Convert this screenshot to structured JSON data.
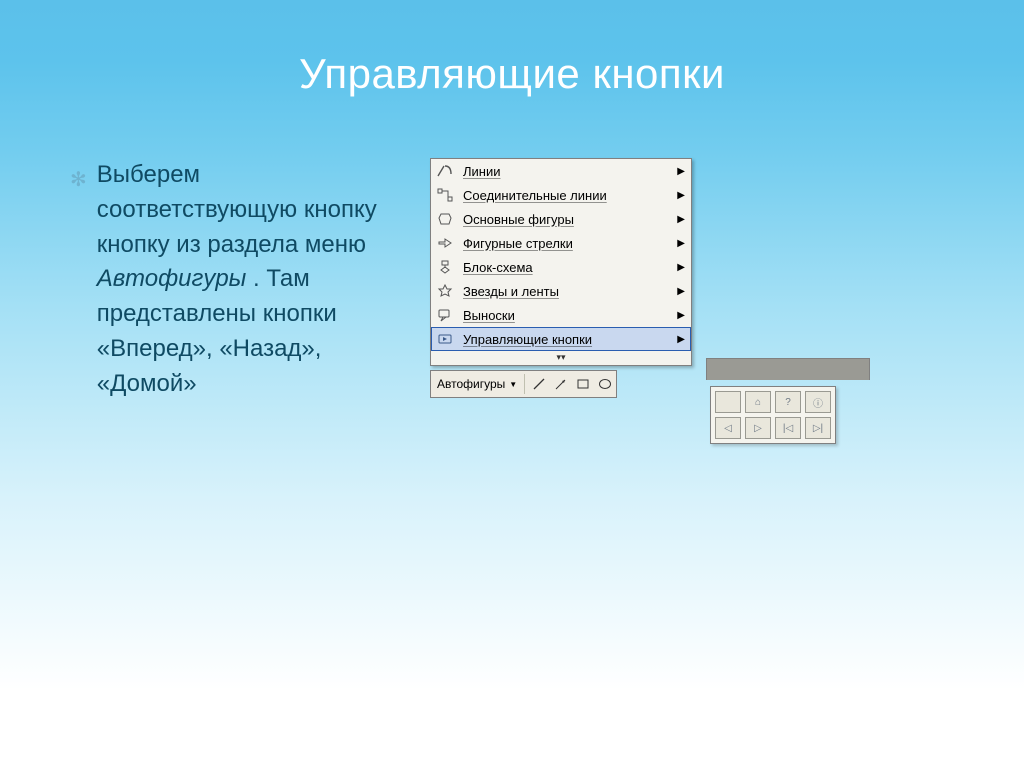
{
  "slide": {
    "title": "Управляющие кнопки",
    "body_pre": "Выберем соответствующую кнопку кнопку из раздела меню ",
    "body_italic": "Автофигуры",
    "body_post": " . Там представлены кнопки «Вперед», «Назад», «Домой»"
  },
  "menu": {
    "items": [
      {
        "icon": "lines",
        "label": "Линии"
      },
      {
        "icon": "connectors",
        "label": "Соединительные линии"
      },
      {
        "icon": "basic-shapes",
        "label": "Основные фигуры"
      },
      {
        "icon": "block-arrows",
        "label": "Фигурные стрелки"
      },
      {
        "icon": "flowchart",
        "label": "Блок-схема"
      },
      {
        "icon": "stars",
        "label": "Звезды и ленты"
      },
      {
        "icon": "callouts",
        "label": "Выноски"
      },
      {
        "icon": "action-btns",
        "label": "Управляющие кнопки"
      }
    ],
    "selected_index": 7,
    "expand_glyph": "▾"
  },
  "toolbar": {
    "label": "Автофигуры",
    "tools": [
      "line",
      "arrow",
      "rect",
      "oval"
    ]
  },
  "action_grid": {
    "rows": 2,
    "cols": 4,
    "glyphs": [
      "",
      "⌂",
      "?",
      "ⓘ",
      "◁",
      "▷",
      "|◁",
      "▷|"
    ]
  }
}
